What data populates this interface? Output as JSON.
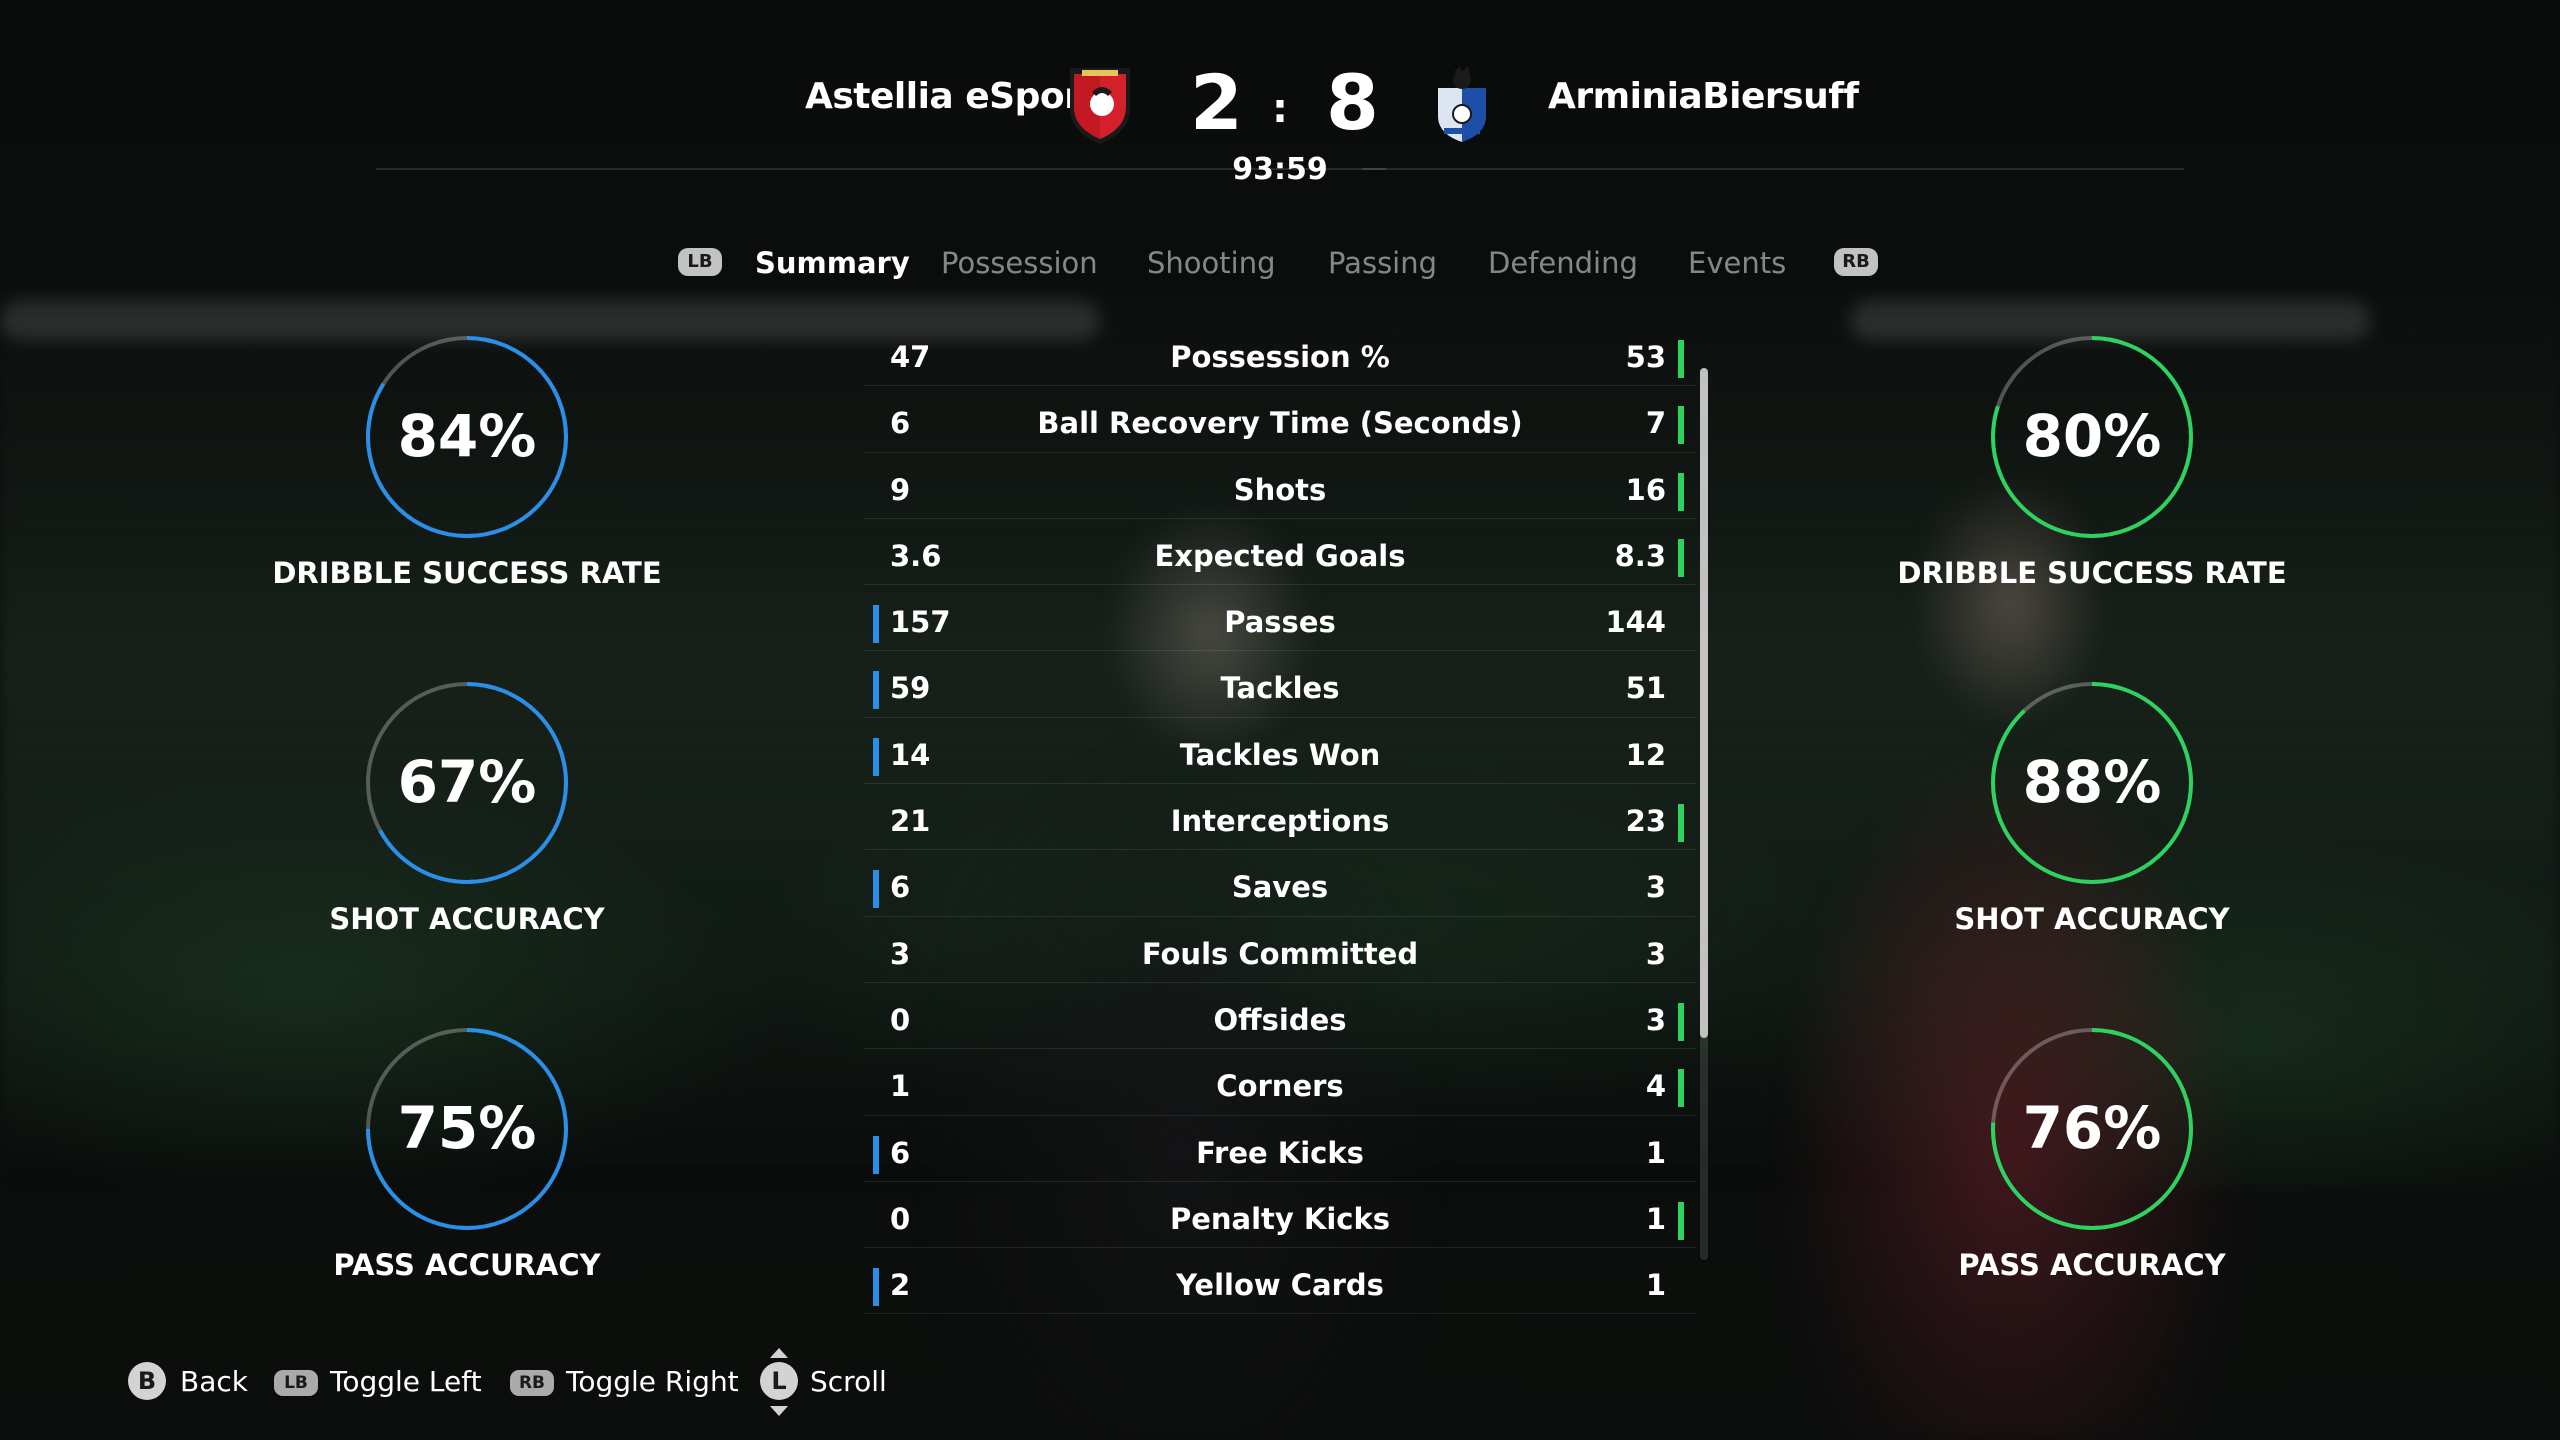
{
  "match": {
    "home_team": "Astellia eSport",
    "away_team": "ArminiaBiersuff",
    "home_score": "2",
    "away_score": "8",
    "separator": ":",
    "clock": "93:59"
  },
  "tabs": {
    "lb": "LB",
    "rb": "RB",
    "items": [
      "Summary",
      "Possession",
      "Shooting",
      "Passing",
      "Defending",
      "Events"
    ],
    "active": "Summary"
  },
  "stats": [
    {
      "label": "Possession %",
      "home": "47",
      "away": "53",
      "leader": "away"
    },
    {
      "label": "Ball Recovery Time (Seconds)",
      "home": "6",
      "away": "7",
      "leader": "away"
    },
    {
      "label": "Shots",
      "home": "9",
      "away": "16",
      "leader": "away"
    },
    {
      "label": "Expected Goals",
      "home": "3.6",
      "away": "8.3",
      "leader": "away"
    },
    {
      "label": "Passes",
      "home": "157",
      "away": "144",
      "leader": "home"
    },
    {
      "label": "Tackles",
      "home": "59",
      "away": "51",
      "leader": "home"
    },
    {
      "label": "Tackles Won",
      "home": "14",
      "away": "12",
      "leader": "home"
    },
    {
      "label": "Interceptions",
      "home": "21",
      "away": "23",
      "leader": "away"
    },
    {
      "label": "Saves",
      "home": "6",
      "away": "3",
      "leader": "home"
    },
    {
      "label": "Fouls Committed",
      "home": "3",
      "away": "3",
      "leader": "none"
    },
    {
      "label": "Offsides",
      "home": "0",
      "away": "3",
      "leader": "away"
    },
    {
      "label": "Corners",
      "home": "1",
      "away": "4",
      "leader": "away"
    },
    {
      "label": "Free Kicks",
      "home": "6",
      "away": "1",
      "leader": "home"
    },
    {
      "label": "Penalty Kicks",
      "home": "0",
      "away": "1",
      "leader": "away"
    },
    {
      "label": "Yellow Cards",
      "home": "2",
      "away": "1",
      "leader": "home"
    }
  ],
  "home_rings": [
    {
      "value": "84%",
      "fraction": 0.84,
      "label": "DRIBBLE SUCCESS RATE"
    },
    {
      "value": "67%",
      "fraction": 0.67,
      "label": "SHOT ACCURACY"
    },
    {
      "value": "75%",
      "fraction": 0.75,
      "label": "PASS ACCURACY"
    }
  ],
  "away_rings": [
    {
      "value": "80%",
      "fraction": 0.8,
      "label": "DRIBBLE SUCCESS RATE"
    },
    {
      "value": "88%",
      "fraction": 0.88,
      "label": "SHOT ACCURACY"
    },
    {
      "value": "76%",
      "fraction": 0.76,
      "label": "PASS ACCURACY"
    }
  ],
  "colors": {
    "home": "#2a8fe8",
    "away": "#2ed35f",
    "track": "rgba(255,255,255,0.28)"
  },
  "footer": {
    "back_key": "B",
    "back": "Back",
    "toggle_left_key": "LB",
    "toggle_left": "Toggle Left",
    "toggle_right_key": "RB",
    "toggle_right": "Toggle Right",
    "scroll_key": "L",
    "scroll": "Scroll"
  }
}
